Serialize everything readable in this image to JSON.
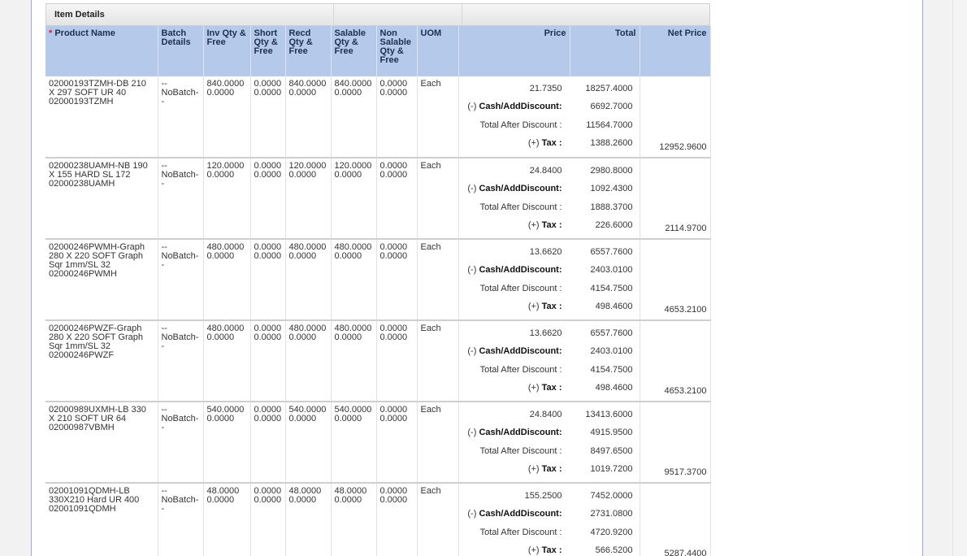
{
  "grid": {
    "section_title": "Item Details",
    "columns": {
      "required_mark": "*",
      "product": "Product Name",
      "batch": "Batch Details",
      "inv": "Inv Qty & Free",
      "short": "Short Qty & Free",
      "recd": "Recd Qty & Free",
      "salable": "Salable Qty & Free",
      "nonsalable": "Non Salable Qty & Free",
      "uom": "UOM",
      "price": "Price",
      "total": "Total",
      "net": "Net Price"
    },
    "labels": {
      "discount_prefix": "(-)",
      "discount": "Cash/AddDiscount:",
      "after_discount": "Total After Discount :",
      "tax_prefix": "(+)",
      "tax": "Tax :"
    },
    "rows": [
      {
        "product": "02000193TZMH-DB 210 X 297 SOFT UR 40 02000193TZMH",
        "batch": "-- NoBatch- -",
        "inv": "840.0000 0.0000",
        "short": "0.0000 0.0000",
        "recd": "840.0000 0.0000",
        "salable": "840.0000 0.0000",
        "nonsalable": "0.0000 0.0000",
        "uom": "Each",
        "price": "21.7350",
        "total": "18257.4000",
        "discount": "6692.7000",
        "after_discount": "11564.7000",
        "tax": "1388.2600",
        "net": "12952.9600"
      },
      {
        "product": "02000238UAMH-NB 190 X 155 HARD SL 172 02000238UAMH",
        "batch": "-- NoBatch- -",
        "inv": "120.0000 0.0000",
        "short": "0.0000 0.0000",
        "recd": "120.0000 0.0000",
        "salable": "120.0000 0.0000",
        "nonsalable": "0.0000 0.0000",
        "uom": "Each",
        "price": "24.8400",
        "total": "2980.8000",
        "discount": "1092.4300",
        "after_discount": "1888.3700",
        "tax": "226.6000",
        "net": "2114.9700"
      },
      {
        "product": "02000246PWMH-Graph 280 X 220 SOFT Graph Sqr 1mm/SL 32 02000246PWMH",
        "batch": "-- NoBatch- -",
        "inv": "480.0000 0.0000",
        "short": "0.0000 0.0000",
        "recd": "480.0000 0.0000",
        "salable": "480.0000 0.0000",
        "nonsalable": "0.0000 0.0000",
        "uom": "Each",
        "price": "13.6620",
        "total": "6557.7600",
        "discount": "2403.0100",
        "after_discount": "4154.7500",
        "tax": "498.4600",
        "net": "4653.2100"
      },
      {
        "product": "02000246PWZF-Graph 280 X 220 SOFT Graph Sqr 1mm/SL 32 02000246PWZF",
        "batch": "-- NoBatch- -",
        "inv": "480.0000 0.0000",
        "short": "0.0000 0.0000",
        "recd": "480.0000 0.0000",
        "salable": "480.0000 0.0000",
        "nonsalable": "0.0000 0.0000",
        "uom": "Each",
        "price": "13.6620",
        "total": "6557.7600",
        "discount": "2403.0100",
        "after_discount": "4154.7500",
        "tax": "498.4600",
        "net": "4653.2100"
      },
      {
        "product": "02000989UXMH-LB 330 X 210 SOFT UR 64 02000987VBMH",
        "batch": "-- NoBatch- -",
        "inv": "540.0000 0.0000",
        "short": "0.0000 0.0000",
        "recd": "540.0000 0.0000",
        "salable": "540.0000 0.0000",
        "nonsalable": "0.0000 0.0000",
        "uom": "Each",
        "price": "24.8400",
        "total": "13413.6000",
        "discount": "4915.9500",
        "after_discount": "8497.6500",
        "tax": "1019.7200",
        "net": "9517.3700"
      },
      {
        "product": "02001091QDMH-LB 330X210 Hard UR 400 02001091QDMH",
        "batch": "-- NoBatch- -",
        "inv": "48.0000 0.0000",
        "short": "0.0000 0.0000",
        "recd": "48.0000 0.0000",
        "salable": "48.0000 0.0000",
        "nonsalable": "0.0000 0.0000",
        "uom": "Each",
        "price": "155.2500",
        "total": "7452.0000",
        "discount": "2731.0800",
        "after_discount": "4720.9200",
        "tax": "566.5200",
        "net": "5287.4400"
      }
    ]
  }
}
